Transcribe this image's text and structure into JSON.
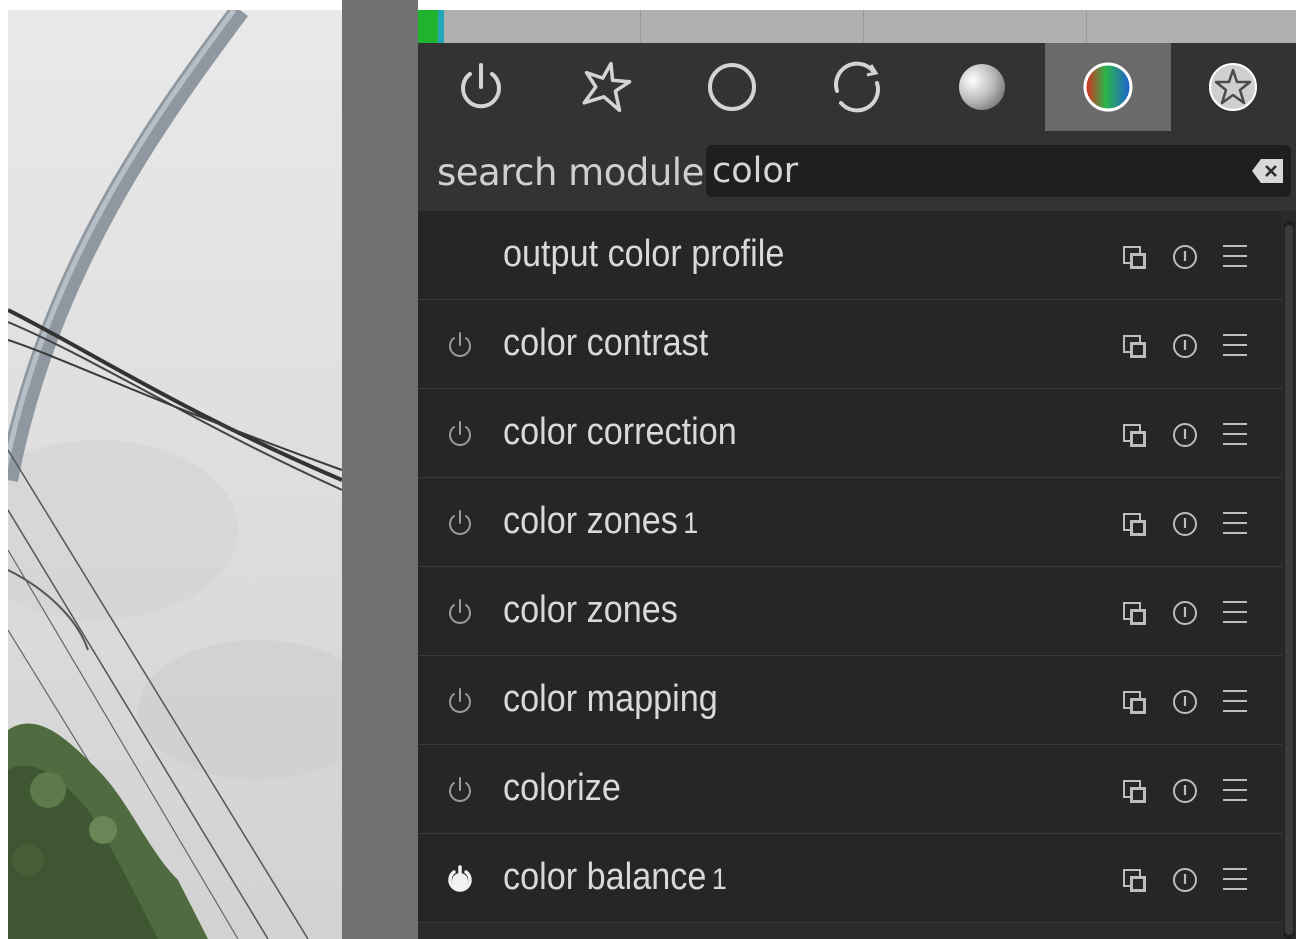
{
  "tabs": [
    {
      "id": "active",
      "icon": "power-icon"
    },
    {
      "id": "favorites",
      "icon": "star-icon"
    },
    {
      "id": "basic",
      "icon": "circle-icon"
    },
    {
      "id": "tone",
      "icon": "rotate-icon"
    },
    {
      "id": "grayscale",
      "icon": "gray-sphere-icon"
    },
    {
      "id": "color",
      "icon": "color-sphere-icon",
      "active": true
    },
    {
      "id": "effects",
      "icon": "effect-star-icon"
    }
  ],
  "search": {
    "label": "search module",
    "value": "color"
  },
  "modules": [
    {
      "name": "output color profile",
      "instance": "",
      "power": "none"
    },
    {
      "name": "color contrast",
      "instance": "",
      "power": "off"
    },
    {
      "name": "color correction",
      "instance": "",
      "power": "off"
    },
    {
      "name": "color zones",
      "instance": "1",
      "power": "off"
    },
    {
      "name": "color zones",
      "instance": "",
      "power": "off"
    },
    {
      "name": "color mapping",
      "instance": "",
      "power": "off"
    },
    {
      "name": "colorize",
      "instance": "",
      "power": "off"
    },
    {
      "name": "color balance",
      "instance": "1",
      "power": "on"
    }
  ],
  "colors": {
    "panel_bg": "#2a2a2a",
    "row_bg": "#262626",
    "text": "#d9d9d9",
    "active_tab": "#6a6a6a",
    "histogram_green": "#1fb32f",
    "histogram_cyan": "#23a7b6"
  }
}
